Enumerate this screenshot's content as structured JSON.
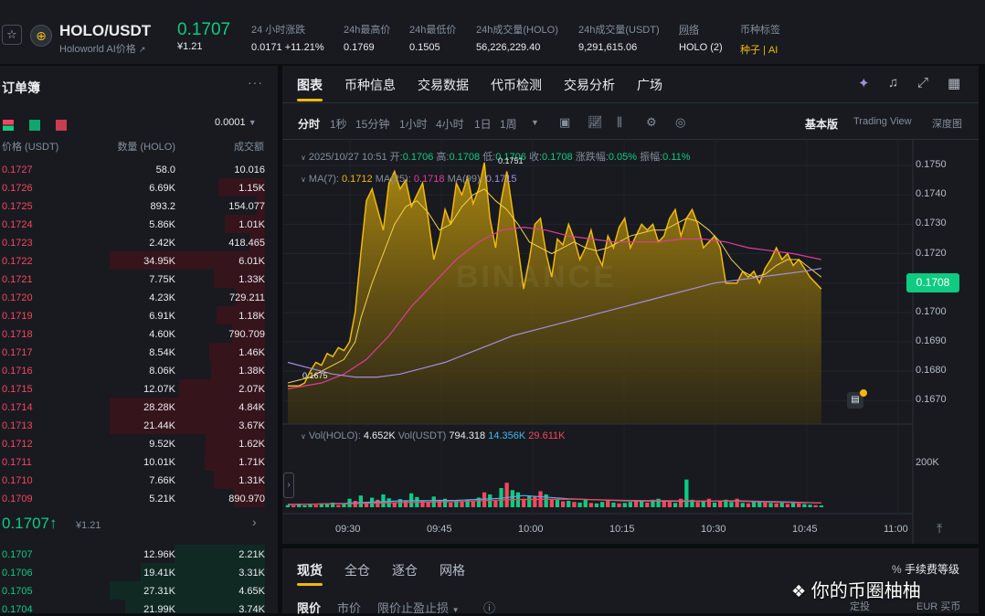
{
  "header": {
    "pair": "HOLO/USDT",
    "subtitle": "Holoworld AI价格",
    "subtitle_link": "↗",
    "price": "0.1707",
    "price_usd": "¥1.21",
    "stats": [
      {
        "label": "24 小时涨跌",
        "value": "0.0171 +11.21%",
        "color": "#0ecb81"
      },
      {
        "label": "24h最高价",
        "value": "0.1769"
      },
      {
        "label": "24h最低价",
        "value": "0.1505"
      },
      {
        "label": "24h成交量(HOLO)",
        "value": "56,226,229.40"
      },
      {
        "label": "24h成交量(USDT)",
        "value": "9,291,615.06"
      },
      {
        "label": "网络",
        "value": "HOLO (2)"
      },
      {
        "label": "币种标签",
        "value": "种子 | AI",
        "color": "#f0b90b"
      }
    ]
  },
  "orderbook": {
    "title": "订单簿",
    "menu": "···",
    "precision": "0.0001",
    "headers": [
      "价格 (USDT)",
      "数量 (HOLO)",
      "成交额"
    ],
    "asks": [
      {
        "price": "0.1727",
        "qty": "58.0",
        "total": "10.016",
        "depth": 0.0
      },
      {
        "price": "0.1726",
        "qty": "6.69K",
        "total": "1.15K",
        "depth": 0.3
      },
      {
        "price": "0.1725",
        "qty": "893.2",
        "total": "154.077",
        "depth": 0.05
      },
      {
        "price": "0.1724",
        "qty": "5.86K",
        "total": "1.01K",
        "depth": 0.26
      },
      {
        "price": "0.1723",
        "qty": "2.42K",
        "total": "418.465",
        "depth": 0.1
      },
      {
        "price": "0.1722",
        "qty": "34.95K",
        "total": "6.01K",
        "depth": 1.0
      },
      {
        "price": "0.1721",
        "qty": "7.75K",
        "total": "1.33K",
        "depth": 0.33
      },
      {
        "price": "0.1720",
        "qty": "4.23K",
        "total": "729.211",
        "depth": 0.19
      },
      {
        "price": "0.1719",
        "qty": "6.91K",
        "total": "1.18K",
        "depth": 0.31
      },
      {
        "price": "0.1718",
        "qty": "4.60K",
        "total": "790.709",
        "depth": 0.21
      },
      {
        "price": "0.1717",
        "qty": "8.54K",
        "total": "1.46K",
        "depth": 0.36
      },
      {
        "price": "0.1716",
        "qty": "8.06K",
        "total": "1.38K",
        "depth": 0.35
      },
      {
        "price": "0.1715",
        "qty": "12.07K",
        "total": "2.07K",
        "depth": 0.55
      },
      {
        "price": "0.1714",
        "qty": "28.28K",
        "total": "4.84K",
        "depth": 1.0
      },
      {
        "price": "0.1713",
        "qty": "21.44K",
        "total": "3.67K",
        "depth": 1.0
      },
      {
        "price": "0.1712",
        "qty": "9.52K",
        "total": "1.62K",
        "depth": 0.38
      },
      {
        "price": "0.1711",
        "qty": "10.01K",
        "total": "1.71K",
        "depth": 0.39
      },
      {
        "price": "0.1710",
        "qty": "7.66K",
        "total": "1.31K",
        "depth": 0.33
      },
      {
        "price": "0.1709",
        "qty": "5.21K",
        "total": "890.970",
        "depth": 0.2
      }
    ],
    "last_price": "0.1707",
    "last_arrow": "↑",
    "last_usd": "¥1.21",
    "more": "›",
    "bids": [
      {
        "price": "0.1707",
        "qty": "12.96K",
        "total": "2.21K",
        "depth": 0.58
      },
      {
        "price": "0.1706",
        "qty": "19.41K",
        "total": "3.31K",
        "depth": 0.8
      },
      {
        "price": "0.1705",
        "qty": "27.31K",
        "total": "4.65K",
        "depth": 1.0
      },
      {
        "price": "0.1704",
        "qty": "21.99K",
        "total": "3.74K",
        "depth": 0.9
      }
    ]
  },
  "chart_panel": {
    "tabs": [
      "图表",
      "币种信息",
      "交易数据",
      "代币检测",
      "交易分析",
      "广场"
    ],
    "intervals": [
      "分时",
      "1秒",
      "15分钟",
      "1小时",
      "4小时",
      "1日",
      "1周"
    ],
    "views": [
      "基本版",
      "Trading View",
      "深度图"
    ],
    "ohlc": {
      "date": "2025/10/27 10:51",
      "open_label": "开:",
      "open": "0.1706",
      "high_label": "高:",
      "high": "0.1708",
      "low_label": "低:",
      "low": "0.1706",
      "close_label": "收:",
      "close": "0.1708",
      "chg_label": "涨跌幅:",
      "chg": "0.05%",
      "amp_label": "振幅:",
      "amp": "0.11%"
    },
    "ma": {
      "ma7_label": "MA(7):",
      "ma7": "0.1712",
      "ma25_label": "MA(25):",
      "ma25": "0.1718",
      "ma99_label": "MA(99):",
      "ma99": "0.1715"
    },
    "vol": {
      "label1": "Vol(HOLO):",
      "v1": "4.652K",
      "label2": "Vol(USDT)",
      "v2": "794.318",
      "v3": "14.356K",
      "v4": "29.611K"
    },
    "current_price_tag": "0.1708",
    "max_label": "0.1751",
    "min_label": "0.1675",
    "watermark": "BINANCE"
  },
  "chart_data": {
    "type": "area",
    "title": "",
    "x_ticks": [
      "09:30",
      "09:45",
      "10:00",
      "10:15",
      "10:30",
      "10:45",
      "11:00"
    ],
    "price_axis": {
      "ticks": [
        "0.1750",
        "0.1740",
        "0.1730",
        "0.1720",
        "0.1710",
        "0.1700",
        "0.1690",
        "0.1680",
        "0.1670"
      ],
      "range": [
        0.1662,
        0.1755
      ]
    },
    "volume_axis": {
      "ticks": [
        "200K"
      ],
      "range": [
        0,
        270
      ]
    },
    "x_minutes": [
      0,
      110
    ],
    "price": [
      [
        0,
        0.1675
      ],
      [
        2,
        0.1675
      ],
      [
        3,
        0.1676
      ],
      [
        4,
        0.168
      ],
      [
        5,
        0.1683
      ],
      [
        6,
        0.1682
      ],
      [
        7,
        0.1686
      ],
      [
        8,
        0.1685
      ],
      [
        9,
        0.1688
      ],
      [
        10,
        0.1687
      ],
      [
        11,
        0.169
      ],
      [
        12,
        0.17
      ],
      [
        13,
        0.172
      ],
      [
        14,
        0.1738
      ],
      [
        15,
        0.1742
      ],
      [
        16,
        0.1735
      ],
      [
        17,
        0.1728
      ],
      [
        18,
        0.1744
      ],
      [
        19,
        0.1748
      ],
      [
        20,
        0.1742
      ],
      [
        21,
        0.1745
      ],
      [
        22,
        0.1736
      ],
      [
        23,
        0.174
      ],
      [
        24,
        0.1744
      ],
      [
        25,
        0.1732
      ],
      [
        26,
        0.1718
      ],
      [
        27,
        0.1725
      ],
      [
        28,
        0.1735
      ],
      [
        29,
        0.173
      ],
      [
        30,
        0.1744
      ],
      [
        31,
        0.174
      ],
      [
        32,
        0.1746
      ],
      [
        33,
        0.1737
      ],
      [
        34,
        0.1742
      ],
      [
        35,
        0.1751
      ],
      [
        36,
        0.1732
      ],
      [
        37,
        0.1722
      ],
      [
        38,
        0.1738
      ],
      [
        39,
        0.1748
      ],
      [
        40,
        0.1735
      ],
      [
        41,
        0.1722
      ],
      [
        42,
        0.1708
      ],
      [
        43,
        0.1718
      ],
      [
        44,
        0.173
      ],
      [
        45,
        0.1732
      ],
      [
        46,
        0.172
      ],
      [
        47,
        0.1712
      ],
      [
        48,
        0.1725
      ],
      [
        49,
        0.1723
      ],
      [
        50,
        0.173
      ],
      [
        51,
        0.1725
      ],
      [
        52,
        0.1718
      ],
      [
        53,
        0.1722
      ],
      [
        54,
        0.1728
      ],
      [
        55,
        0.172
      ],
      [
        56,
        0.1716
      ],
      [
        57,
        0.1726
      ],
      [
        58,
        0.1722
      ],
      [
        59,
        0.1729
      ],
      [
        60,
        0.1732
      ],
      [
        61,
        0.1722
      ],
      [
        62,
        0.1726
      ],
      [
        63,
        0.173
      ],
      [
        64,
        0.1728
      ],
      [
        65,
        0.173
      ],
      [
        66,
        0.1724
      ],
      [
        67,
        0.1726
      ],
      [
        68,
        0.1732
      ],
      [
        69,
        0.1735
      ],
      [
        70,
        0.1726
      ],
      [
        71,
        0.1732
      ],
      [
        72,
        0.1735
      ],
      [
        73,
        0.173
      ],
      [
        74,
        0.1722
      ],
      [
        75,
        0.1724
      ],
      [
        76,
        0.1726
      ],
      [
        77,
        0.1722
      ],
      [
        78,
        0.171
      ],
      [
        79,
        0.171
      ],
      [
        80,
        0.171
      ],
      [
        81,
        0.1714
      ],
      [
        82,
        0.1712
      ],
      [
        83,
        0.1714
      ],
      [
        84,
        0.171
      ],
      [
        85,
        0.1715
      ],
      [
        86,
        0.1718
      ],
      [
        87,
        0.1722
      ],
      [
        88,
        0.1718
      ],
      [
        89,
        0.172
      ],
      [
        90,
        0.1716
      ],
      [
        91,
        0.1718
      ],
      [
        92,
        0.1715
      ],
      [
        93,
        0.1712
      ],
      [
        94,
        0.171
      ],
      [
        95,
        0.1708
      ]
    ],
    "ma7": [
      [
        0,
        0.1676
      ],
      [
        4,
        0.1678
      ],
      [
        8,
        0.1682
      ],
      [
        10,
        0.1684
      ],
      [
        12,
        0.169
      ],
      [
        13,
        0.1698
      ],
      [
        15,
        0.171
      ],
      [
        17,
        0.172
      ],
      [
        19,
        0.173
      ],
      [
        21,
        0.1736
      ],
      [
        23,
        0.1738
      ],
      [
        25,
        0.1734
      ],
      [
        27,
        0.1728
      ],
      [
        29,
        0.173
      ],
      [
        31,
        0.1736
      ],
      [
        33,
        0.174
      ],
      [
        35,
        0.1742
      ],
      [
        37,
        0.1738
      ],
      [
        39,
        0.1735
      ],
      [
        41,
        0.173
      ],
      [
        43,
        0.1724
      ],
      [
        45,
        0.1722
      ],
      [
        47,
        0.172
      ],
      [
        49,
        0.1722
      ],
      [
        51,
        0.1724
      ],
      [
        53,
        0.1722
      ],
      [
        55,
        0.1721
      ],
      [
        57,
        0.1722
      ],
      [
        59,
        0.1724
      ],
      [
        61,
        0.1726
      ],
      [
        63,
        0.1727
      ],
      [
        65,
        0.1728
      ],
      [
        67,
        0.1728
      ],
      [
        69,
        0.173
      ],
      [
        71,
        0.1732
      ],
      [
        73,
        0.1731
      ],
      [
        75,
        0.1728
      ],
      [
        77,
        0.1724
      ],
      [
        79,
        0.1718
      ],
      [
        81,
        0.1714
      ],
      [
        83,
        0.1712
      ],
      [
        85,
        0.1713
      ],
      [
        87,
        0.1716
      ],
      [
        89,
        0.1718
      ],
      [
        91,
        0.1718
      ],
      [
        93,
        0.1715
      ],
      [
        95,
        0.1712
      ]
    ],
    "ma25": [
      [
        0,
        0.1674
      ],
      [
        6,
        0.1676
      ],
      [
        10,
        0.1679
      ],
      [
        14,
        0.1684
      ],
      [
        18,
        0.1692
      ],
      [
        22,
        0.1702
      ],
      [
        26,
        0.171
      ],
      [
        30,
        0.1718
      ],
      [
        34,
        0.1724
      ],
      [
        38,
        0.1728
      ],
      [
        42,
        0.1729
      ],
      [
        46,
        0.1728
      ],
      [
        50,
        0.1726
      ],
      [
        54,
        0.1725
      ],
      [
        58,
        0.1724
      ],
      [
        62,
        0.1724
      ],
      [
        66,
        0.1724
      ],
      [
        70,
        0.1725
      ],
      [
        74,
        0.1725
      ],
      [
        78,
        0.1724
      ],
      [
        82,
        0.1722
      ],
      [
        86,
        0.1721
      ],
      [
        90,
        0.172
      ],
      [
        95,
        0.1718
      ]
    ],
    "ma99": [
      [
        0,
        0.1683
      ],
      [
        4,
        0.1681
      ],
      [
        8,
        0.1679
      ],
      [
        12,
        0.1678
      ],
      [
        16,
        0.1678
      ],
      [
        20,
        0.1679
      ],
      [
        24,
        0.1681
      ],
      [
        28,
        0.1683
      ],
      [
        32,
        0.1686
      ],
      [
        36,
        0.1689
      ],
      [
        40,
        0.1692
      ],
      [
        44,
        0.1694
      ],
      [
        48,
        0.1696
      ],
      [
        52,
        0.1698
      ],
      [
        56,
        0.17
      ],
      [
        60,
        0.1702
      ],
      [
        64,
        0.1704
      ],
      [
        68,
        0.1706
      ],
      [
        72,
        0.1708
      ],
      [
        76,
        0.171
      ],
      [
        80,
        0.1711
      ],
      [
        84,
        0.1712
      ],
      [
        88,
        0.1713
      ],
      [
        92,
        0.1714
      ],
      [
        95,
        0.1715
      ]
    ],
    "volume": [
      10,
      8,
      12,
      9,
      15,
      11,
      18,
      14,
      22,
      10,
      16,
      40,
      30,
      55,
      25,
      45,
      35,
      60,
      42,
      20,
      38,
      28,
      65,
      48,
      30,
      25,
      50,
      35,
      40,
      22,
      30,
      26,
      34,
      28,
      45,
      70,
      60,
      30,
      90,
      115,
      80,
      70,
      40,
      55,
      50,
      75,
      60,
      40,
      35,
      28,
      30,
      25,
      22,
      35,
      20,
      18,
      25,
      30,
      22,
      18,
      20,
      25,
      30,
      28,
      22,
      35,
      40,
      30,
      25,
      20,
      40,
      130,
      35,
      25,
      30,
      40,
      22,
      30,
      35,
      25,
      40,
      20,
      18,
      25,
      30,
      22,
      20,
      18,
      25,
      15,
      20,
      18,
      15,
      12,
      10,
      8
    ],
    "volume_up": [
      1,
      0,
      1,
      1,
      1,
      0,
      1,
      1,
      1,
      0,
      1,
      1,
      0,
      1,
      0,
      1,
      0,
      1,
      1,
      0,
      1,
      0,
      1,
      1,
      0,
      0,
      1,
      0,
      1,
      0,
      1,
      0,
      1,
      0,
      1,
      0,
      1,
      0,
      1,
      0,
      1,
      1,
      0,
      1,
      0,
      0,
      1,
      0,
      1,
      0,
      1,
      0,
      1,
      1,
      0,
      1,
      1,
      0,
      1,
      0,
      1,
      1,
      0,
      1,
      0,
      1,
      1,
      0,
      0,
      1,
      0,
      1,
      1,
      0,
      1,
      0,
      1,
      0,
      1,
      1,
      0,
      1,
      0,
      1,
      1,
      0,
      1,
      0,
      1,
      0,
      1,
      0,
      1,
      1,
      0,
      1
    ],
    "vol_ma_blue": [
      [
        0,
        12
      ],
      [
        10,
        18
      ],
      [
        20,
        30
      ],
      [
        30,
        32
      ],
      [
        38,
        42
      ],
      [
        42,
        55
      ],
      [
        50,
        40
      ],
      [
        60,
        30
      ],
      [
        70,
        28
      ],
      [
        80,
        30
      ],
      [
        90,
        24
      ],
      [
        95,
        20
      ]
    ],
    "vol_ma_red": [
      [
        0,
        14
      ],
      [
        10,
        16
      ],
      [
        20,
        22
      ],
      [
        30,
        26
      ],
      [
        40,
        36
      ],
      [
        50,
        38
      ],
      [
        60,
        32
      ],
      [
        70,
        30
      ],
      [
        80,
        28
      ],
      [
        90,
        22
      ],
      [
        95,
        20
      ]
    ]
  },
  "bottom_panel": {
    "tabs": [
      "现货",
      "全仓",
      "逐仓",
      "网格"
    ],
    "fee_label": "手续费等级",
    "order_types": [
      "限价",
      "市价",
      "限价止盈止损"
    ],
    "info": "ⓘ",
    "bottom_right": [
      "定投",
      "EUR 买币"
    ]
  },
  "watermark_text": "你的币圈柚柚",
  "colors": {
    "up": "#0ecb81",
    "down": "#f6465d",
    "accent": "#f0b90b",
    "ma25": "#e03b9a",
    "ma99": "#a58de0",
    "vol_blue": "#45b6f0"
  }
}
